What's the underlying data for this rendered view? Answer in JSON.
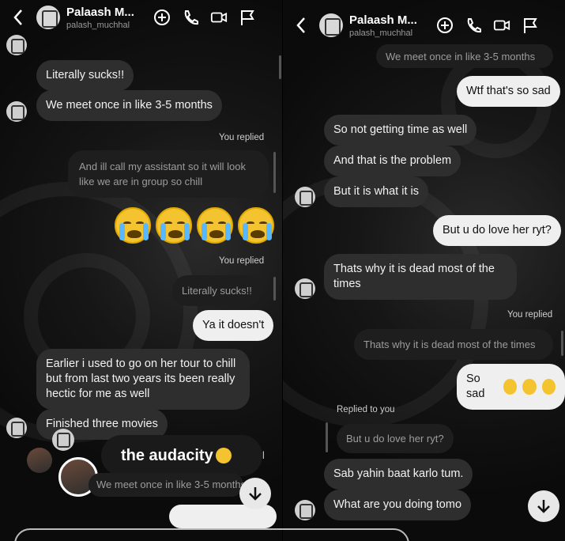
{
  "header": {
    "name": "Palaash M...",
    "username": "palash_muchhal"
  },
  "left": {
    "messages": [
      {
        "kind": "in",
        "text": "Literally sucks!!"
      },
      {
        "kind": "in",
        "text": "We meet  once in like 3-5 months"
      },
      {
        "kind": "meta",
        "text": "You replied"
      },
      {
        "kind": "rep",
        "text": "And ill call my assistant so it will look like we are in group so chill"
      },
      {
        "kind": "meta",
        "text": "You replied"
      },
      {
        "kind": "rep",
        "text": "Literally sucks!!"
      },
      {
        "kind": "out",
        "text": "Ya it doesn't"
      },
      {
        "kind": "in",
        "text": "Earlier i used to go on her tour to chill but from last two years its been really hectic for me as well"
      },
      {
        "kind": "in",
        "text": "Finished three movies"
      },
      {
        "kind": "rep",
        "text": "We meet  once in like 3-5 months"
      }
    ],
    "floating_text": "the audacity",
    "emoji_count": 4
  },
  "right": {
    "messages": [
      {
        "kind": "in",
        "text": "We meet  once in like 3-5 months"
      },
      {
        "kind": "out",
        "text": "Wtf that's so sad"
      },
      {
        "kind": "in",
        "text": "So not getting time as well"
      },
      {
        "kind": "in",
        "text": "And that is the problem"
      },
      {
        "kind": "in",
        "text": "But it is what it is"
      },
      {
        "kind": "out",
        "text": "But u do love her ryt?"
      },
      {
        "kind": "in",
        "text": "Thats why it is dead most of the times"
      },
      {
        "kind": "meta",
        "text": "You replied"
      },
      {
        "kind": "rep",
        "text": "Thats why it is dead most of the times"
      },
      {
        "kind": "out",
        "text": "So sad"
      },
      {
        "kind": "meta",
        "text": "Replied to you"
      },
      {
        "kind": "rep",
        "text": "But u do love her ryt?"
      },
      {
        "kind": "in",
        "text": "Sab yahin baat karlo tum."
      },
      {
        "kind": "in",
        "text": "What are you doing tomo"
      }
    ]
  },
  "icons": [
    "back-chevron-icon",
    "avatar-icon",
    "sticker-plus-icon",
    "phone-icon",
    "video-camera-icon",
    "flag-icon",
    "arrow-down-icon",
    "crying-emoji-icon"
  ],
  "colors": {
    "incoming": "#2e2e2e",
    "outgoing": "#efefef",
    "reply": "#1e1e1e"
  }
}
